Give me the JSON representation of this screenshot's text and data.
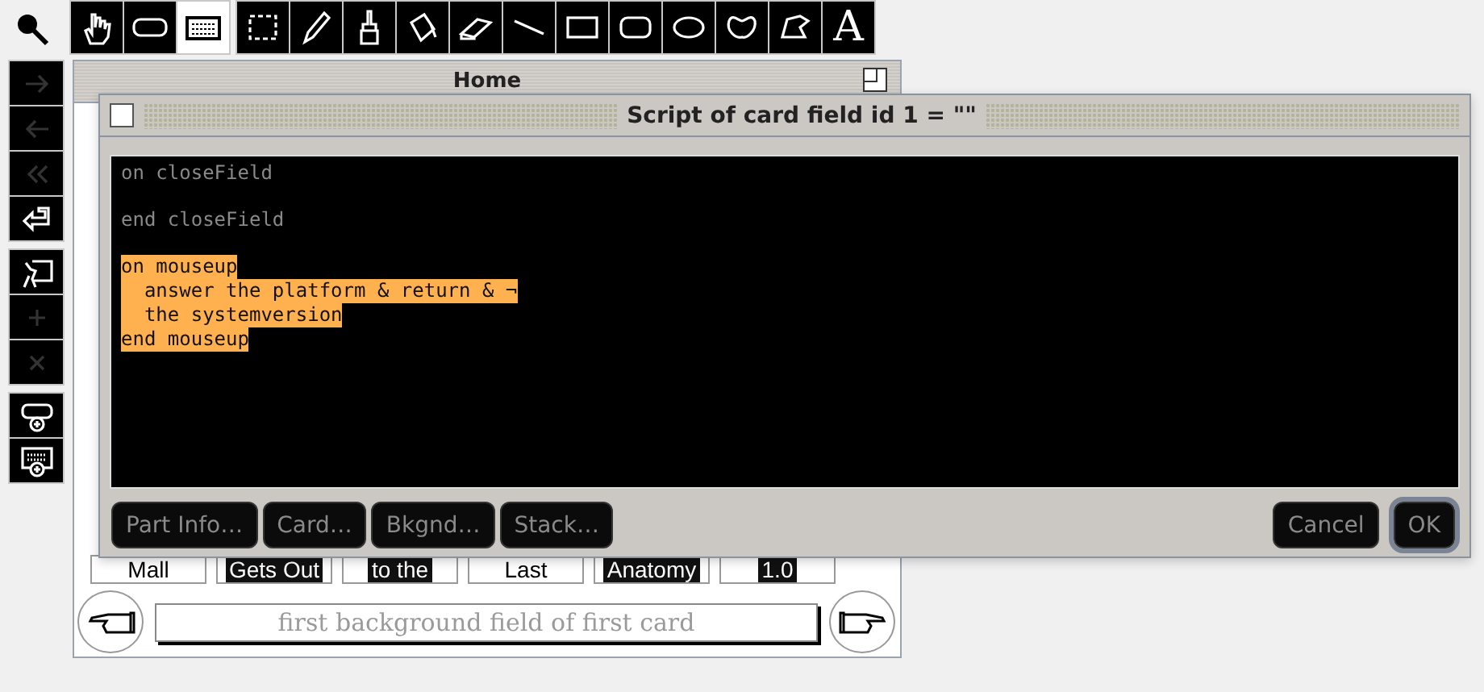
{
  "tool_palette": {
    "tools": [
      {
        "kind": "browse",
        "selected": false
      },
      {
        "kind": "button",
        "selected": false
      },
      {
        "kind": "field",
        "selected": true
      },
      {
        "kind": "select",
        "selected": false
      },
      {
        "kind": "pencil",
        "selected": false
      },
      {
        "kind": "brush",
        "selected": false
      },
      {
        "kind": "bucket",
        "selected": false
      },
      {
        "kind": "eraser",
        "selected": false
      },
      {
        "kind": "line",
        "selected": false
      },
      {
        "kind": "rectangle",
        "selected": false
      },
      {
        "kind": "rounded",
        "selected": false
      },
      {
        "kind": "oval",
        "selected": false
      },
      {
        "kind": "curve",
        "selected": false
      },
      {
        "kind": "polygon",
        "selected": false
      },
      {
        "kind": "text",
        "selected": false,
        "label": "A"
      }
    ]
  },
  "navigation_palette": {
    "groups": [
      [
        {
          "kind": "next",
          "disabled": true
        },
        {
          "kind": "prev",
          "disabled": true
        },
        {
          "kind": "back",
          "disabled": true
        },
        {
          "kind": "return",
          "disabled": false
        }
      ],
      [
        {
          "kind": "edit",
          "disabled": false
        },
        {
          "kind": "add",
          "disabled": true
        },
        {
          "kind": "delete",
          "disabled": true
        }
      ],
      [
        {
          "kind": "new-button",
          "disabled": false
        },
        {
          "kind": "new-field",
          "disabled": false
        }
      ]
    ]
  },
  "home_window": {
    "title": "Home",
    "card_fields": [
      {
        "text": "Mall",
        "inverted": false
      },
      {
        "text": "Gets Out",
        "inverted": true
      },
      {
        "text": "to the",
        "inverted": true
      },
      {
        "text": "Last",
        "inverted": false
      },
      {
        "text": "Anatomy",
        "inverted": true
      },
      {
        "text": "1.0",
        "inverted": true
      }
    ],
    "background_field": "first background field of first card"
  },
  "script_window": {
    "title": "Script of card field id 1 = \"\"",
    "lines": [
      {
        "text": "on closeField",
        "selected": false
      },
      {
        "text": "end closeField",
        "selected": false,
        "space_before": true
      },
      {
        "text": "on mouseup",
        "selected": true,
        "space_before": true
      },
      {
        "text": "  answer the platform & return & ¬",
        "selected": true
      },
      {
        "text": "  the systemversion",
        "selected": true
      },
      {
        "text": "end mouseup",
        "selected": true
      }
    ],
    "left_buttons": [
      {
        "label": "Part Info…",
        "default": false
      },
      {
        "label": "Card…",
        "default": false
      },
      {
        "label": "Bkgnd…",
        "default": false
      },
      {
        "label": "Stack…",
        "default": false
      }
    ],
    "right_buttons": [
      {
        "label": "Cancel",
        "default": false
      },
      {
        "label": "OK",
        "default": true
      }
    ]
  }
}
